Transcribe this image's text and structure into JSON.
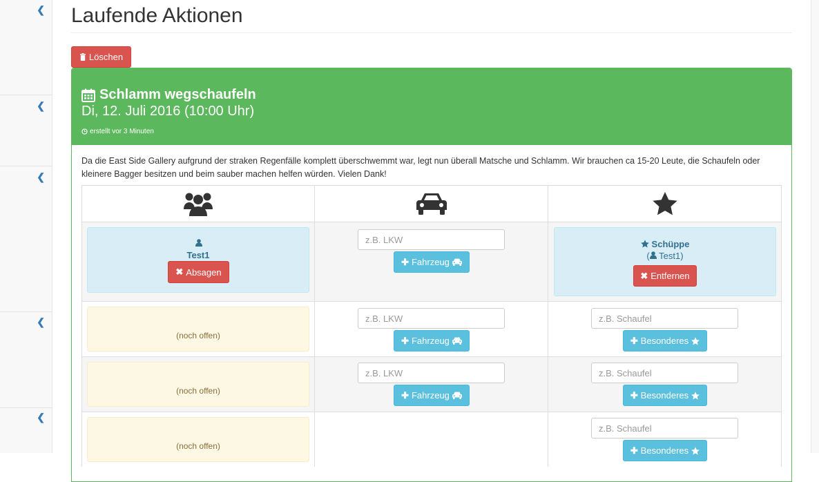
{
  "page": {
    "title": "Laufende Aktionen",
    "delete_label": "Löschen"
  },
  "event": {
    "title": "Schlamm wegschaufeln",
    "date": "Di, 12. Juli 2016 (10:00 Uhr)",
    "created": "erstellt vor 3 Minuten",
    "description": "Da die East Side Gallery aufgrund der straken Regenfälle komplett überschwemmt war, legt nun überall Matsche und Schlamm. Wir brauchen ca 15-20 Leute, die Schaufeln oder kleinere Bagger besitzen und beim sauber machen helfen würden. Vielen Dank!"
  },
  "table": {
    "col_icons": [
      "users-icon",
      "car-icon",
      "star-icon"
    ],
    "row1": {
      "person": "Test1",
      "cancel_label": "Absagen",
      "vehicle_placeholder": "z.B. LKW",
      "vehicle_button": "Fahrzeug",
      "special_item": "Schüppe",
      "special_owner": "Test1",
      "remove_label": "Entfernen"
    },
    "open_rows": [
      {
        "status": "(noch offen)",
        "vehicle_placeholder": "z.B. LKW",
        "vehicle_button": "Fahrzeug",
        "special_placeholder": "z.B. Schaufel",
        "special_button": "Besonderes"
      },
      {
        "status": "(noch offen)",
        "vehicle_placeholder": "z.B. LKW",
        "vehicle_button": "Fahrzeug",
        "special_placeholder": "z.B. Schaufel",
        "special_button": "Besonderes"
      },
      {
        "status": "(noch offen)",
        "special_placeholder": "z.B. Schaufel",
        "special_button": "Besonderes"
      }
    ]
  },
  "colors": {
    "success": "#5cb85c",
    "danger": "#d9534f",
    "info": "#5bc0de"
  }
}
